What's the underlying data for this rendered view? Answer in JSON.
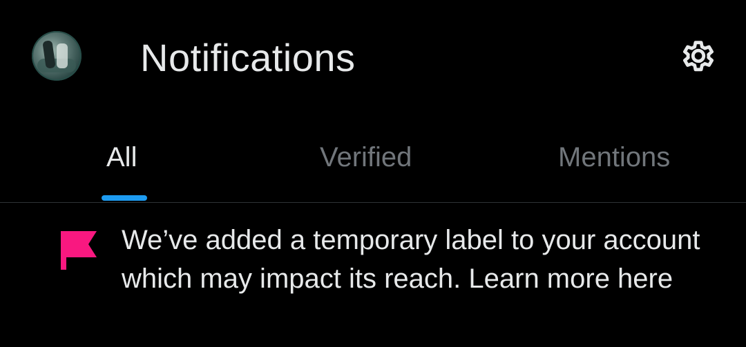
{
  "header": {
    "title": "Notifications",
    "avatar_icon": "profile-avatar",
    "settings_icon": "gear-icon"
  },
  "tabs": [
    {
      "label": "All",
      "active": true
    },
    {
      "label": "Verified",
      "active": false
    },
    {
      "label": "Mentions",
      "active": false
    }
  ],
  "notice": {
    "icon": "flag-icon",
    "icon_color": "#f91880",
    "text": "We’ve added a temporary label to your account which may impact its reach. Learn more here"
  },
  "colors": {
    "background": "#000000",
    "text_primary": "#e7e9ea",
    "text_secondary": "#71767b",
    "accent": "#1d9bf0",
    "divider": "#2f3336"
  }
}
